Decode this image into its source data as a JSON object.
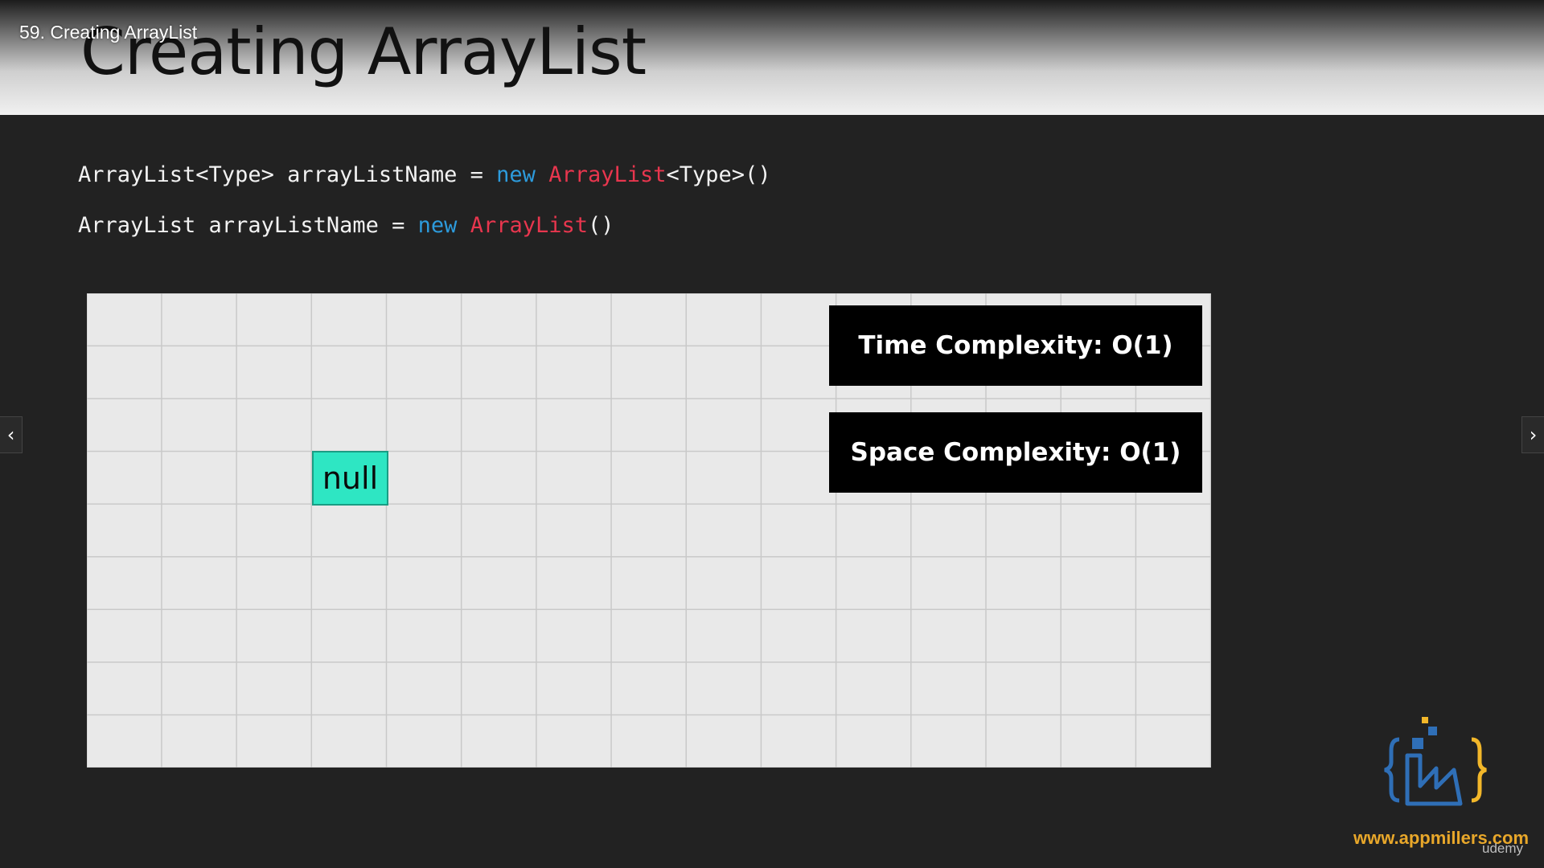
{
  "header": {
    "lecture_title": "59. Creating ArrayList",
    "slide_title": "Creating ArrayList"
  },
  "code": {
    "line1": {
      "part1": "ArrayList<Type> arrayListName = ",
      "keyword": "new",
      "space": " ",
      "class_name": "ArrayList",
      "part2": "<Type>()"
    },
    "line2": {
      "part1": "ArrayList arrayListName = ",
      "keyword": "new",
      "space": " ",
      "class_name": "ArrayList",
      "part2": "()"
    }
  },
  "board": {
    "cell_value": "null",
    "time_complexity": "Time Complexity: O(1)",
    "space_complexity": "Space Complexity: O(1)"
  },
  "nav": {
    "prev_icon": "chevron-left-icon",
    "next_icon": "chevron-right-icon",
    "prev_glyph": "‹",
    "next_glyph": "›"
  },
  "branding": {
    "url": "www.appmillers.com",
    "platform": "udemy"
  },
  "colors": {
    "keyword": "#2d9bdc",
    "class_name": "#e8364e",
    "null_cell": "#2ee6c3",
    "logo_blue": "#2f6fb7",
    "logo_yellow": "#f2b72a"
  }
}
